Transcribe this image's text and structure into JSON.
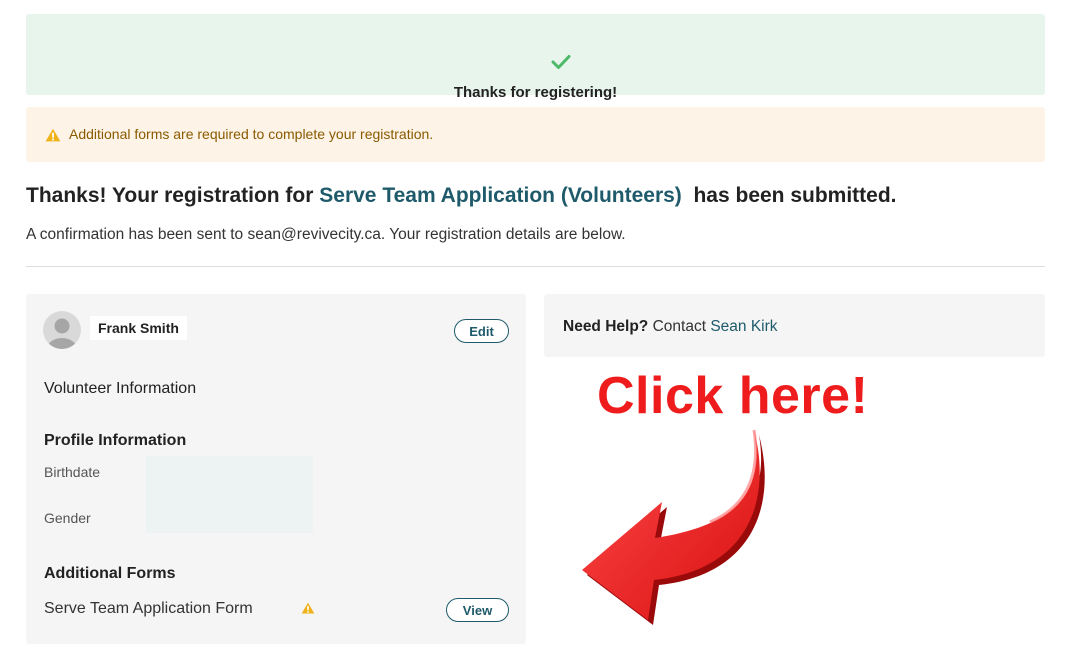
{
  "success_banner": {
    "title": "Thanks for registering!",
    "icon": "check-icon",
    "color": "#4cb868"
  },
  "warning_banner": {
    "text": "Additional forms are required to complete your registration.",
    "icon": "warning-icon",
    "color": "#f0b21a"
  },
  "confirmation": {
    "prefix": "Thanks! Your registration for ",
    "event_name": "Serve Team Application (Volunteers)",
    "suffix": "has been submitted.",
    "subtext": "A confirmation has been sent to sean@revivecity.ca. Your registration details are below."
  },
  "registrant_card": {
    "name": "Frank Smith",
    "edit_label": "Edit",
    "category": "Volunteer Information",
    "profile_section": "Profile Information",
    "fields": [
      {
        "label": "Birthdate"
      },
      {
        "label": "Gender"
      }
    ],
    "additional_forms_section": "Additional Forms",
    "forms": [
      {
        "name": "Serve Team Application Form",
        "view_label": "View"
      }
    ]
  },
  "help": {
    "label": "Need Help?",
    "contact_prefix": "Contact",
    "contact_name": "Sean Kirk"
  },
  "annotation": {
    "text": "Click here!",
    "color": "#ee1c1c"
  },
  "colors": {
    "accent": "#1e5a6a"
  }
}
